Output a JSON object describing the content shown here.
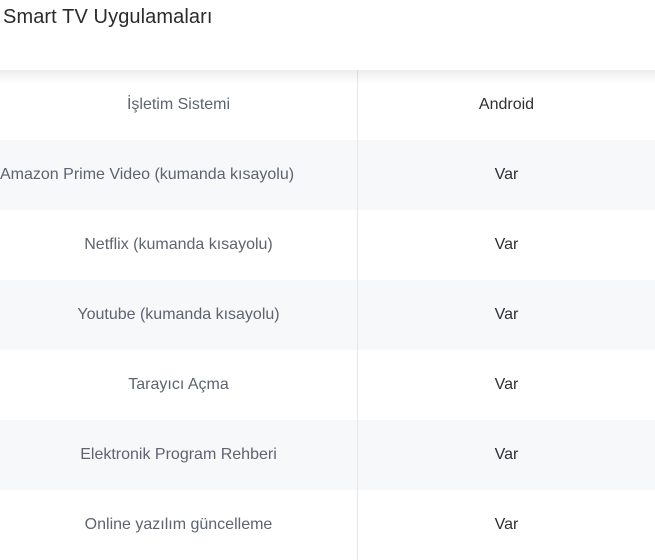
{
  "section": {
    "title": "Smart TV Uygulamaları"
  },
  "table": {
    "rows": [
      {
        "label": "İşletim Sistemi",
        "value": "Android"
      },
      {
        "label": "Amazon Prime Video (kumanda kısayolu)",
        "value": "Var"
      },
      {
        "label": "Netflix (kumanda kısayolu)",
        "value": "Var"
      },
      {
        "label": "Youtube (kumanda kısayolu)",
        "value": "Var"
      },
      {
        "label": "Tarayıcı Açma",
        "value": "Var"
      },
      {
        "label": "Elektronik Program Rehberi",
        "value": "Var"
      },
      {
        "label": "Online yazılım güncelleme",
        "value": "Var"
      }
    ]
  },
  "colors": {
    "alt_row_background": "#f7f8fa",
    "label_text": "#5d6470",
    "value_text": "#2f3033",
    "divider": "#e4e6ea"
  }
}
